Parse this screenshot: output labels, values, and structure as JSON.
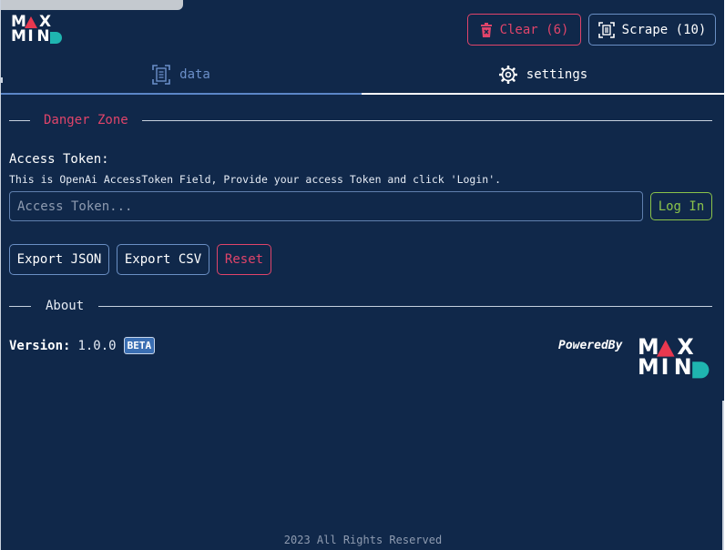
{
  "brand": {
    "logo_line1": [
      "M",
      "X"
    ],
    "logo_line2": [
      "M",
      "I",
      "N"
    ],
    "logo_text": "MAX MIND",
    "colors": {
      "background": "#10284a",
      "danger": "#e0446a",
      "accent": "#5b86c7",
      "success": "#8bc34a",
      "logo_red": "#e8384f",
      "logo_teal": "#1fb5b0"
    }
  },
  "header": {
    "clear_label": "Clear (6)",
    "clear_icon": "trash-icon",
    "scrape_label": "Scrape (10)",
    "scrape_icon": "scan-document-icon"
  },
  "tabs": [
    {
      "label": "data",
      "icon": "document-scan-icon",
      "active": false
    },
    {
      "label": "settings",
      "icon": "gear-icon",
      "active": true
    }
  ],
  "danger_zone": {
    "title": "Danger Zone",
    "token_label": "Access Token:",
    "token_help": "This is OpenAi AccessToken Field, Provide your access Token and click 'Login'.",
    "token_placeholder": "Access Token...",
    "token_value": "",
    "login_label": "Log In",
    "export_json_label": "Export JSON",
    "export_csv_label": "Export CSV",
    "reset_label": "Reset"
  },
  "about": {
    "title": "About",
    "version_key": "Version:",
    "version_value": "1.0.0",
    "badge": "BETA",
    "powered_by": "PoweredBy"
  },
  "footer": {
    "text": "2023 All Rights Reserved"
  }
}
